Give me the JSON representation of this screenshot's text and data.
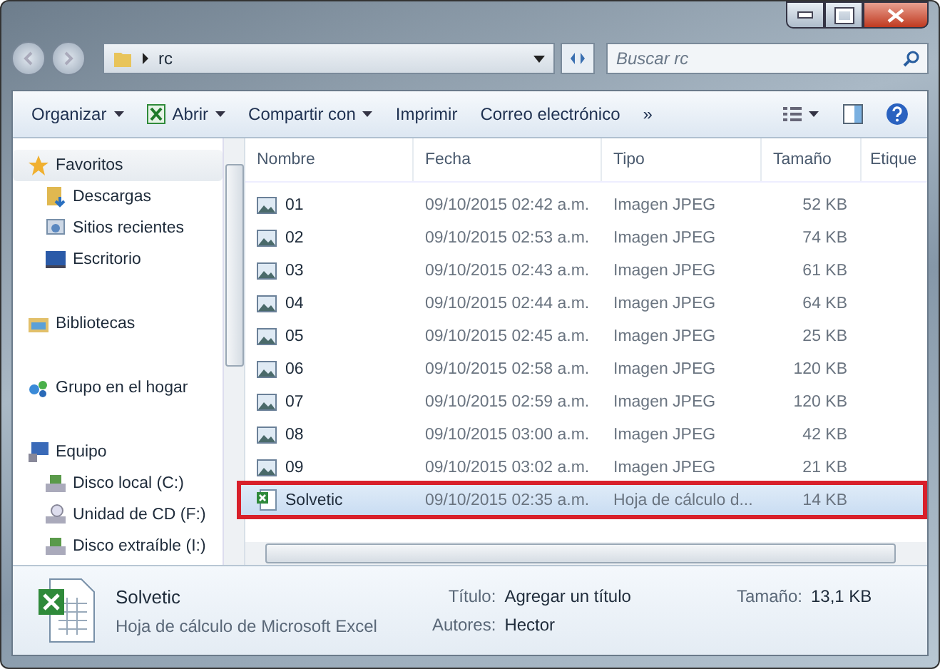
{
  "address": {
    "crumbs": [
      "rc"
    ]
  },
  "search": {
    "placeholder": "Buscar rc"
  },
  "toolbar": [
    {
      "label": "Organizar",
      "dropdown": true
    },
    {
      "label": "Abrir",
      "dropdown": true
    },
    {
      "label": "Compartir con",
      "dropdown": true
    },
    {
      "label": "Imprimir",
      "dropdown": false
    },
    {
      "label": "Correo electrónico",
      "dropdown": false
    }
  ],
  "more": "»",
  "sidebar": [
    {
      "label": "Favoritos",
      "kind": "group",
      "selected": true
    },
    {
      "label": "Descargas",
      "kind": "item",
      "selected": false
    },
    {
      "label": "Sitios recientes",
      "kind": "item",
      "selected": false
    },
    {
      "label": "Escritorio",
      "kind": "item",
      "selected": false
    },
    {
      "label": "Bibliotecas",
      "kind": "group",
      "selected": false
    },
    {
      "label": "Grupo en el hogar",
      "kind": "group",
      "selected": false
    },
    {
      "label": "Equipo",
      "kind": "group",
      "selected": false
    },
    {
      "label": "Disco local (C:)",
      "kind": "item",
      "selected": false
    },
    {
      "label": "Unidad de CD (F:)",
      "kind": "item",
      "selected": false
    },
    {
      "label": "Disco extraíble (I:)",
      "kind": "item",
      "selected": false
    }
  ],
  "table": {
    "columns": [
      "Nombre",
      "Fecha",
      "Tipo",
      "Tamaño",
      "Etique"
    ],
    "rows": [
      {
        "name": "01",
        "date": "09/10/2015 02:42 a.m.",
        "type": "Imagen JPEG",
        "size": "52 KB",
        "kind": "image",
        "selected": false
      },
      {
        "name": "02",
        "date": "09/10/2015 02:53 a.m.",
        "type": "Imagen JPEG",
        "size": "74 KB",
        "kind": "image",
        "selected": false
      },
      {
        "name": "03",
        "date": "09/10/2015 02:43 a.m.",
        "type": "Imagen JPEG",
        "size": "61 KB",
        "kind": "image",
        "selected": false
      },
      {
        "name": "04",
        "date": "09/10/2015 02:44 a.m.",
        "type": "Imagen JPEG",
        "size": "64 KB",
        "kind": "image",
        "selected": false
      },
      {
        "name": "05",
        "date": "09/10/2015 02:45 a.m.",
        "type": "Imagen JPEG",
        "size": "25 KB",
        "kind": "image",
        "selected": false
      },
      {
        "name": "06",
        "date": "09/10/2015 02:58 a.m.",
        "type": "Imagen JPEG",
        "size": "120 KB",
        "kind": "image",
        "selected": false
      },
      {
        "name": "07",
        "date": "09/10/2015 02:59 a.m.",
        "type": "Imagen JPEG",
        "size": "120 KB",
        "kind": "image",
        "selected": false
      },
      {
        "name": "08",
        "date": "09/10/2015 03:00 a.m.",
        "type": "Imagen JPEG",
        "size": "42 KB",
        "kind": "image",
        "selected": false
      },
      {
        "name": "09",
        "date": "09/10/2015 03:02 a.m.",
        "type": "Imagen JPEG",
        "size": "21 KB",
        "kind": "image",
        "selected": false
      },
      {
        "name": "Solvetic",
        "date": "09/10/2015 02:35 a.m.",
        "type": "Hoja de cálculo d...",
        "size": "14 KB",
        "kind": "excel",
        "selected": true
      }
    ]
  },
  "details": {
    "name": "Solvetic",
    "type": "Hoja de cálculo de Microsoft Excel",
    "fields": [
      {
        "label": "Título:",
        "value": "Agregar un título"
      },
      {
        "label": "Autores:",
        "value": "Hector"
      }
    ],
    "size_label": "Tamaño:",
    "size_value": "13,1 KB"
  }
}
